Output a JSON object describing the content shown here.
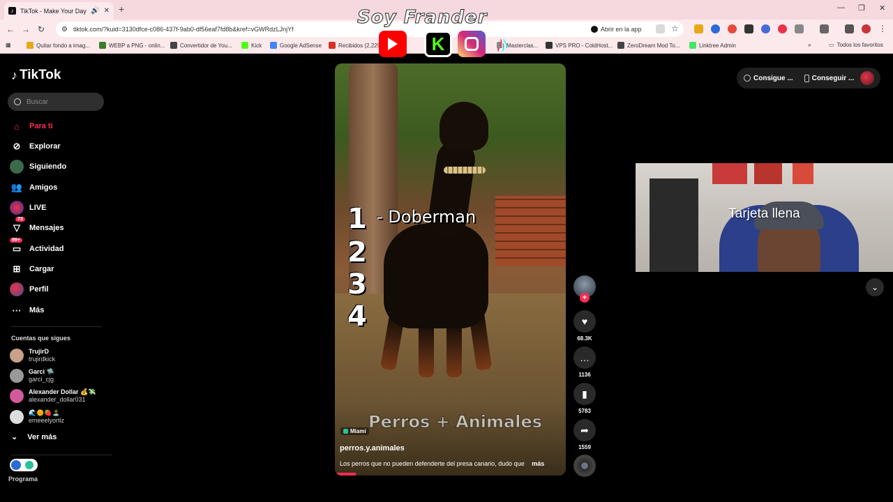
{
  "browser": {
    "tab_title": "TikTok - Make Your Day",
    "url": "tiktok.com/?kuid=3130dfce-c086-437f-9ab0-df56eaf7fd8b&kref=vGWRdzLJnjYf",
    "open_in_app": "Abrir en la app",
    "bookmarks": [
      {
        "label": "Quitar fondo a imag...",
        "color": "#e6a817"
      },
      {
        "label": "WEBP a PNG - onlin...",
        "color": "#3a7d2a"
      },
      {
        "label": "Convertidor de You...",
        "color": "#444444"
      },
      {
        "label": "Kick",
        "color": "#53fc18"
      },
      {
        "label": "Google AdSense",
        "color": "#4285f4"
      },
      {
        "label": "Recibidos (2,229)",
        "color": "#d93025"
      },
      {
        "label": "Masterclas...",
        "color": "#888888"
      },
      {
        "label": "VPS PRO - ColdHost...",
        "color": "#333333"
      },
      {
        "label": "ZeroDream Mod To...",
        "color": "#444444"
      },
      {
        "label": "Linktree Admin",
        "color": "#43e660"
      }
    ],
    "all_bookmarks": "Todos los favoritos"
  },
  "overlay": {
    "streamer_name": "Soy Frander"
  },
  "sidebar": {
    "logo_text": "TikTok",
    "search_placeholder": "Buscar",
    "nav": [
      {
        "label": "Para ti",
        "icon": "home-icon"
      },
      {
        "label": "Explorar",
        "icon": "compass-icon"
      },
      {
        "label": "Siguiendo",
        "icon": "following-icon"
      },
      {
        "label": "Amigos",
        "icon": "friends-icon"
      },
      {
        "label": "LIVE",
        "icon": "live-icon"
      },
      {
        "label": "Mensajes",
        "icon": "messages-icon",
        "badge": "73"
      },
      {
        "label": "Actividad",
        "icon": "activity-icon",
        "badge": "99+"
      },
      {
        "label": "Cargar",
        "icon": "upload-icon"
      },
      {
        "label": "Perfil",
        "icon": "profile-icon"
      },
      {
        "label": "Más",
        "icon": "more-icon"
      }
    ],
    "following_title": "Cuentas que sigues",
    "accounts": [
      {
        "display": "TrujirD",
        "username": "trujirdkick",
        "color": "#c9a089"
      },
      {
        "display": "Garci 🛸",
        "username": "garci_cjg",
        "color": "#999999"
      },
      {
        "display": "Alexander Dollar 💰💸",
        "username": "alexander_dollar031",
        "color": "#d25a9a"
      },
      {
        "display": "🌊🌞🍓🏝️",
        "username": "emeeelyortiz",
        "color": "#dddddd"
      }
    ],
    "see_more": "Ver más",
    "program_label": "Programa"
  },
  "video": {
    "ranks": [
      "1",
      "2",
      "3",
      "4"
    ],
    "rank1_label": "- Doberman",
    "watermark": "Perros + Animales",
    "location": "Miami",
    "author": "perros.y.animales",
    "caption": "Los perros que no pueden defenderte del presa canario, dudo que",
    "more": "más"
  },
  "actions": {
    "likes": "68.3K",
    "comments": "1136",
    "saves": "5783",
    "shares": "1559"
  },
  "header": {
    "pill1": "Consigue ...",
    "pill2": "Conseguir ..."
  },
  "webcam": {
    "caption": "Tarjeta llena"
  }
}
